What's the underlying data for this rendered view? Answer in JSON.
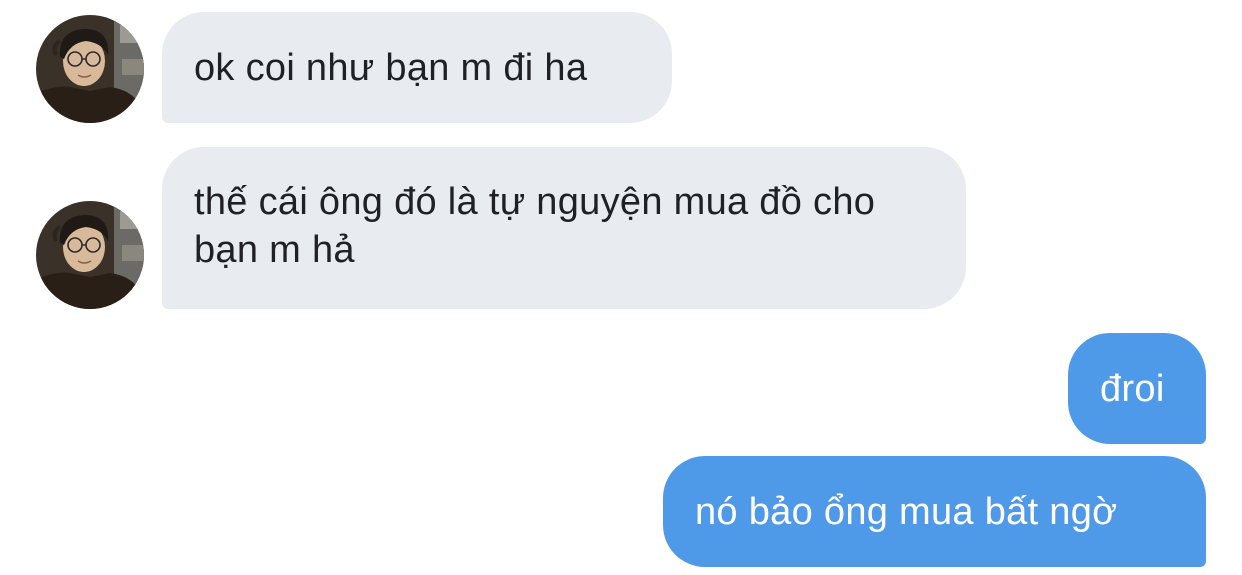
{
  "conversation": {
    "messages": [
      {
        "direction": "incoming",
        "text": "ok coi như bạn m đi ha"
      },
      {
        "direction": "incoming",
        "text": "thế cái ông đó là tự nguyện mua đồ cho bạn m hả"
      },
      {
        "direction": "outgoing",
        "text": "đroi"
      },
      {
        "direction": "outgoing",
        "text": "nó bảo ổng mua bất ngờ"
      }
    ]
  },
  "colors": {
    "incoming_bubble": "#e8ebf0",
    "incoming_text": "#1f2125",
    "outgoing_bubble": "#4f9ae8",
    "outgoing_text": "#ffffff"
  },
  "icons": {
    "avatar": "contact-avatar-photo"
  }
}
